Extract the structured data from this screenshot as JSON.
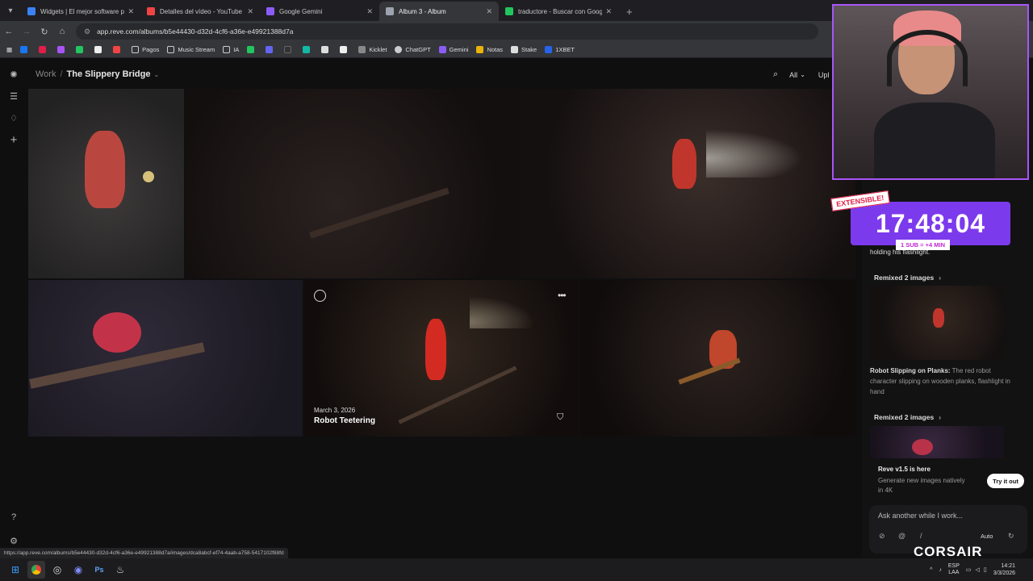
{
  "browser": {
    "tabs": [
      {
        "title": "Widgets | El mejor software pa",
        "color": "#3b82f6"
      },
      {
        "title": "Detalles del vídeo - YouTube St",
        "color": "#ef4444"
      },
      {
        "title": "Google Gemini",
        "color": "#8b5cf6"
      },
      {
        "title": "Album 3 - Album",
        "color": "#9ca3af"
      },
      {
        "title": "traductore - Buscar con Google",
        "color": "#22c55e"
      }
    ],
    "url": "app.reve.com/albums/b5e44430-d32d-4cf6-a36e-e49921388d7a",
    "bookmarks": [
      "Pagos",
      "Music Stream",
      "IA",
      "Kicklet",
      "ChatGPT",
      "Gemini",
      "Notas",
      "Stake",
      "1XBET"
    ]
  },
  "app": {
    "breadcrumb_root": "Work",
    "breadcrumb_separator": "/",
    "album_name": "The Slippery Bridge",
    "filter": "All",
    "upload_label": "Upl",
    "hover_tile": {
      "date": "March 3, 2026",
      "title": "Robot Teetering"
    }
  },
  "sidebar": {
    "partial_text": "holding his flashlight.",
    "remix1": "Remixed 2 images",
    "card_title": "Robot Slipping on Planks:",
    "card_desc": " The red robot character slipping on wooden planks, flashlight in hand",
    "remix2": "Remixed 2 images",
    "reve_title": "Reve v1.5 is here",
    "reve_sub": "Generate new images natively in 4K",
    "try_label": "Try it out",
    "ask_placeholder": "Ask another while I work...",
    "mode": "Auto"
  },
  "overlay": {
    "timer": "17:48:04",
    "extensible": "EXTENSIBLE!",
    "sub_rule": "1 SUB = +4 MIN",
    "brand": "CORSAIR"
  },
  "status_url": "https://app.reve.com/albums/b5e44430-d32d-4cf6-a36e-e49921388d7a/images/dca8abcf-ef74-4aab-a758-5417102f88fd",
  "system": {
    "lang": "ESP",
    "lang2": "LAA",
    "time": "14:21",
    "date": "3/3/2026"
  }
}
